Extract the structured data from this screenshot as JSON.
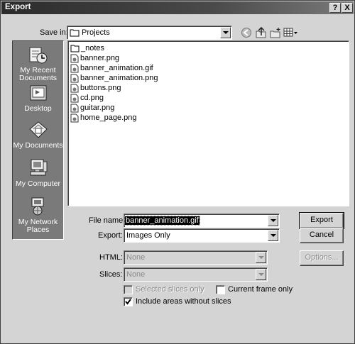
{
  "window": {
    "title": "Export",
    "help_glyph": "?",
    "close_glyph": "X"
  },
  "save_in": {
    "label": "Save in:",
    "value": "Projects"
  },
  "places": [
    {
      "label": "My Recent Documents",
      "icon": "recent-documents-icon"
    },
    {
      "label": "Desktop",
      "icon": "desktop-icon"
    },
    {
      "label": "My Documents",
      "icon": "my-documents-icon"
    },
    {
      "label": "My Computer",
      "icon": "my-computer-icon"
    },
    {
      "label": "My Network Places",
      "icon": "network-places-icon"
    }
  ],
  "files": [
    {
      "name": "_notes",
      "type": "folder"
    },
    {
      "name": "banner.png",
      "type": "image"
    },
    {
      "name": "banner_animation.gif",
      "type": "image"
    },
    {
      "name": "banner_animation.png",
      "type": "image"
    },
    {
      "name": "buttons.png",
      "type": "image"
    },
    {
      "name": "cd.png",
      "type": "image"
    },
    {
      "name": "guitar.png",
      "type": "image"
    },
    {
      "name": "home_page.png",
      "type": "image"
    }
  ],
  "form": {
    "file_name_label": "File name:",
    "file_name_value": "banner_animation.gif",
    "export_label": "Export:",
    "export_value": "Images Only",
    "html_label": "HTML:",
    "html_value": "None",
    "slices_label": "Slices:",
    "slices_value": "None"
  },
  "buttons": {
    "export": "Export",
    "cancel": "Cancel",
    "options": "Options..."
  },
  "checkboxes": {
    "selected_slices_only": {
      "label": "Selected slices only",
      "checked": false,
      "enabled": false
    },
    "current_frame_only": {
      "label": "Current frame only",
      "checked": false,
      "enabled": true
    },
    "include_areas": {
      "label": "Include areas without slices",
      "checked": true,
      "enabled": true
    }
  }
}
